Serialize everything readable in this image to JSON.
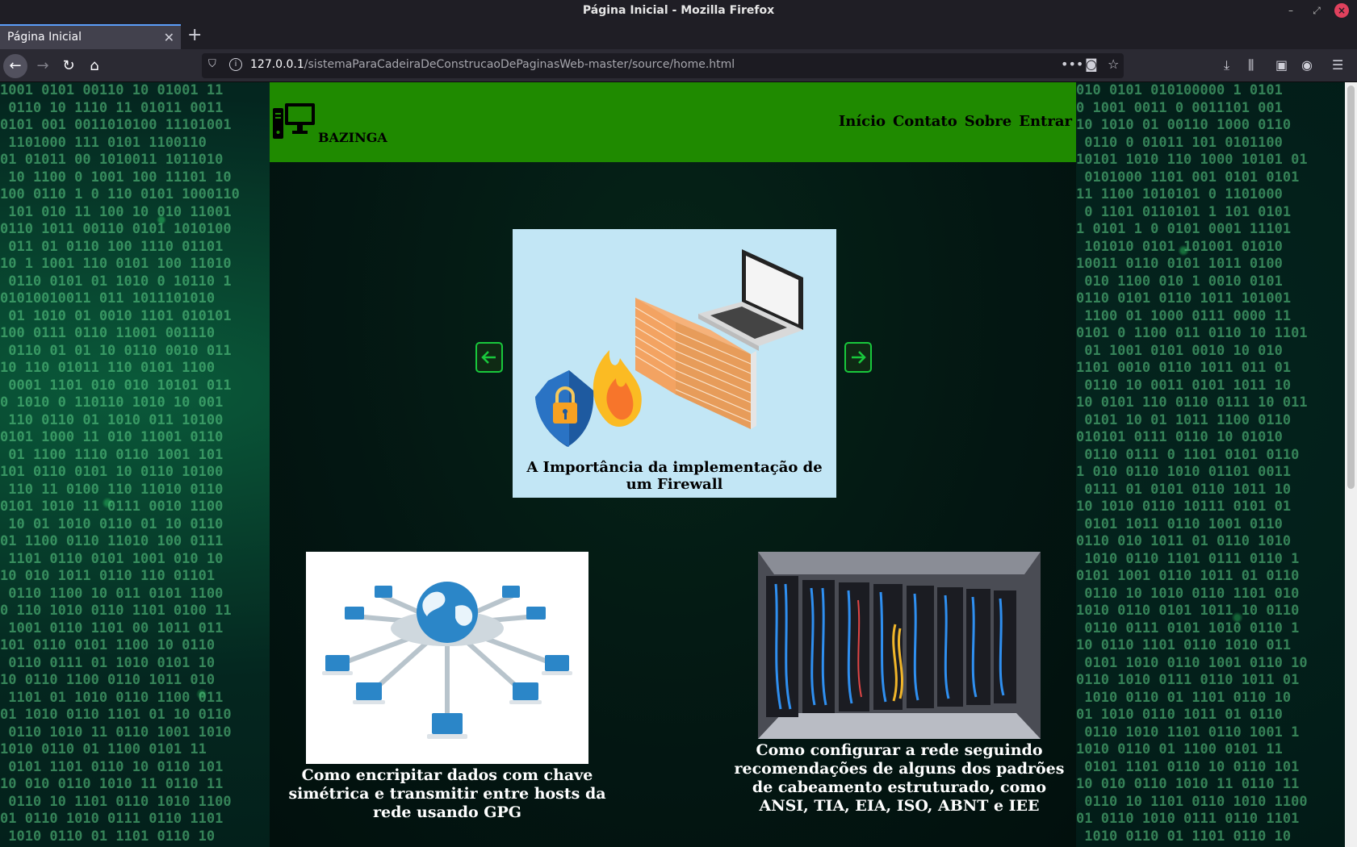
{
  "browser": {
    "window_title": "Página Inicial - Mozilla Firefox",
    "tab_title": "Página Inicial",
    "url_host": "127.0.0.1",
    "url_path": "/sistemaParaCadeiraDeConstrucaoDePaginasWeb-master/source/home.html"
  },
  "site": {
    "brand": "BAZINGA",
    "nav": [
      "Início",
      "Contato",
      "Sobre",
      "Entrar"
    ],
    "carousel": {
      "caption": "A Importância da implementação de um Firewall"
    },
    "cards": [
      {
        "title": "Como encripitar dados com chave simétrica e transmitir entre hosts da rede usando GPG"
      },
      {
        "title": "Como configurar a rede seguindo recomendações de alguns dos padrões de cabeamento estruturado, como ANSI, TIA, EIA, ISO, ABNT e IEE"
      }
    ]
  },
  "colors": {
    "header_green": "#1f8a00",
    "arrow_border": "#19c83c"
  }
}
